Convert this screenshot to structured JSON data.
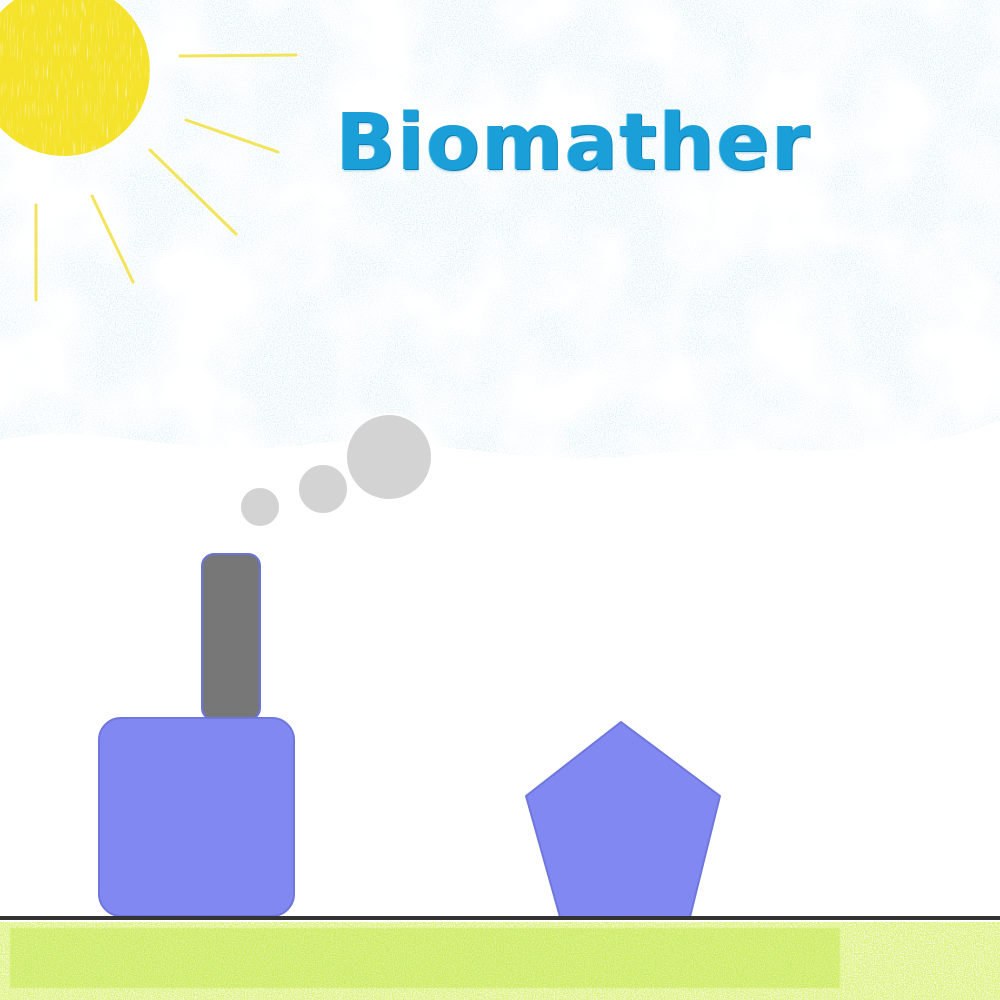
{
  "title": "Biomather",
  "colors": {
    "sky_crayon": "#a6d4e4",
    "sun": "#f5e22a",
    "sun_rays": "#f2e24a",
    "title_text": "#1a9fd8",
    "building": "#8188f2",
    "chimney": "#777777",
    "smoke": "#d3d3d3",
    "ground_line": "#333333",
    "grass": "#b4e22a",
    "background": "#ffffff"
  },
  "scene": {
    "objects": [
      {
        "name": "sun",
        "shape": "circle"
      },
      {
        "name": "smoke-puffs",
        "count": 3
      },
      {
        "name": "chimney",
        "shape": "rounded-rectangle"
      },
      {
        "name": "factory-block",
        "shape": "rounded-square"
      },
      {
        "name": "pentagon-block",
        "shape": "pentagon"
      },
      {
        "name": "ground",
        "shape": "line"
      },
      {
        "name": "grass",
        "shape": "crayon-strip"
      }
    ]
  }
}
